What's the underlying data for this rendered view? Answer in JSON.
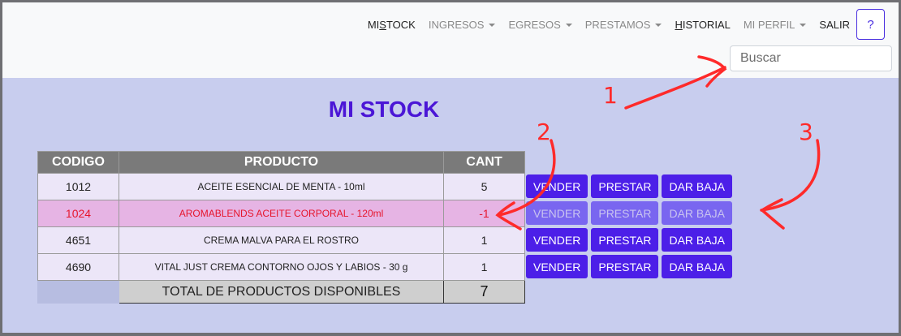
{
  "nav": {
    "items": [
      {
        "label_pre": "MI ",
        "label_u": "S",
        "label_post": "TOCK",
        "dropdown": false,
        "active": true
      },
      {
        "label_pre": "INGRESOS",
        "label_u": "",
        "label_post": "",
        "dropdown": true,
        "active": false
      },
      {
        "label_pre": "EGRESOS",
        "label_u": "",
        "label_post": "",
        "dropdown": true,
        "active": false
      },
      {
        "label_pre": "PRESTAMOS",
        "label_u": "",
        "label_post": "",
        "dropdown": true,
        "active": false
      },
      {
        "label_pre": "",
        "label_u": "H",
        "label_post": "ISTORIAL",
        "dropdown": false,
        "active": true
      },
      {
        "label_pre": "MI PERFIL",
        "label_u": "",
        "label_post": "",
        "dropdown": true,
        "active": false
      },
      {
        "label_pre": "SALIR",
        "label_u": "",
        "label_post": "",
        "dropdown": false,
        "active": true
      }
    ],
    "help_label": "?"
  },
  "search": {
    "placeholder": "Buscar",
    "value": ""
  },
  "page_title": "MI STOCK",
  "table": {
    "headers": [
      "CODIGO",
      "PRODUCTO",
      "CANT"
    ],
    "rows": [
      {
        "codigo": "1012",
        "producto": "ACEITE ESENCIAL DE MENTA - 10ml",
        "cant": "5",
        "negative": false
      },
      {
        "codigo": "1024",
        "producto": "AROMABLENDS ACEITE CORPORAL - 120ml",
        "cant": "-1",
        "negative": true
      },
      {
        "codigo": "4651",
        "producto": "CREMA MALVA PARA EL ROSTRO",
        "cant": "1",
        "negative": false
      },
      {
        "codigo": "4690",
        "producto": "VITAL JUST CREMA CONTORNO OJOS Y LABIOS - 30 g",
        "cant": "1",
        "negative": false
      }
    ],
    "total_label": "TOTAL DE PRODUCTOS DISPONIBLES",
    "total_value": "7"
  },
  "actions": {
    "sell": "VENDER",
    "lend": "PRESTAR",
    "remove": "DAR BAJA"
  },
  "annotations": [
    "1",
    "2",
    "3"
  ],
  "colors": {
    "accent": "#4c1fe8",
    "title": "#4b16d6",
    "negative_text": "#e6162d",
    "negative_row": "#e6b4e4",
    "annotation": "#ff2a2a",
    "background": "#c8cdee"
  }
}
